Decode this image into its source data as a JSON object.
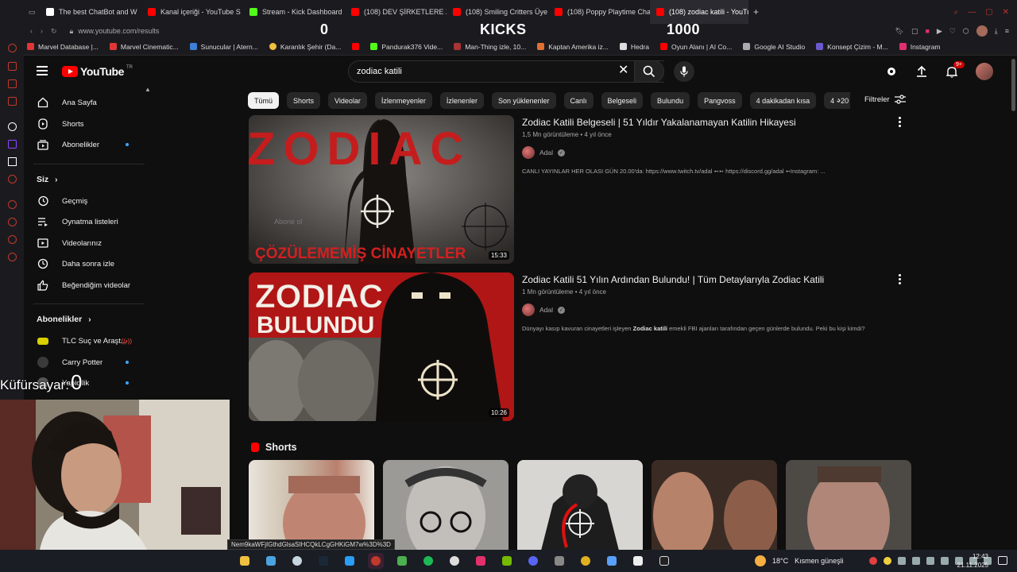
{
  "browser": {
    "tabs": [
      {
        "title": "The best ChatBot and W",
        "color": "#ffffff"
      },
      {
        "title": "Kanal içeriği - YouTube S",
        "color": "#ff0000"
      },
      {
        "title": "Stream - Kick Dashboard",
        "color": "#53fc18"
      },
      {
        "title": "(108) DEV ŞİRKETLERE Z",
        "color": "#ff0000"
      },
      {
        "title": "(108) Smiling Critters Üye",
        "color": "#ff0000"
      },
      {
        "title": "(108) Poppy Playtime Cha",
        "color": "#ff0000"
      },
      {
        "title": "(108) zodiac katili - YouTu",
        "color": "#ff0000"
      }
    ],
    "new_tab": "+",
    "url": "www.youtube.com/results",
    "stream_overlay": {
      "left": "0",
      "center": "KICKS",
      "right": "1000"
    },
    "bookmarks": [
      {
        "label": "Marvel Database |...",
        "color": "#e23636"
      },
      {
        "label": "Marvel Cinematic...",
        "color": "#e23636"
      },
      {
        "label": "Sunucular | Atern...",
        "color": "#3f7fd6"
      },
      {
        "label": "Karanlık Şehir (Da...",
        "color": "#f0c040"
      },
      {
        "label": "",
        "color": "#ff0000"
      },
      {
        "label": "Pandurak376 Vide...",
        "color": "#53fc18"
      },
      {
        "label": "Man-Thing izle, 10...",
        "color": "#aa3333"
      },
      {
        "label": "Kaptan Amerika iz...",
        "color": "#e07030"
      },
      {
        "label": "Hedra",
        "color": "#dddddd"
      },
      {
        "label": "Oyun Alanı | AI Co...",
        "color": "#ff0000"
      },
      {
        "label": "Google AI Studio",
        "color": "#aaaaaa"
      },
      {
        "label": "Konsept Çizim - M...",
        "color": "#6a5acd"
      },
      {
        "label": "Instagram",
        "color": "#e1306c"
      }
    ]
  },
  "youtube": {
    "logo_text": "YouTube",
    "logo_region": "TR",
    "search_value": "zodiac katili",
    "notifications_badge": "9+",
    "sidebar": {
      "main": [
        {
          "label": "Ana Sayfa",
          "icon": "home-icon"
        },
        {
          "label": "Shorts",
          "icon": "shorts-icon"
        },
        {
          "label": "Abonelikler",
          "icon": "subscriptions-icon"
        }
      ],
      "you_header": "Siz",
      "you": [
        {
          "label": "Geçmiş",
          "icon": "history-icon"
        },
        {
          "label": "Oynatma listeleri",
          "icon": "playlists-icon"
        },
        {
          "label": "Videolarınız",
          "icon": "your-videos-icon"
        },
        {
          "label": "Daha sonra izle",
          "icon": "watch-later-icon"
        },
        {
          "label": "Beğendiğim videolar",
          "icon": "liked-icon"
        }
      ],
      "subs_header": "Abonelikler",
      "subs": [
        {
          "label": "TLC Suç ve Araşt..."
        },
        {
          "label": "Carry Potter"
        },
        {
          "label": "Yapicilik"
        }
      ]
    },
    "chips": [
      "Tümü",
      "Shorts",
      "Videolar",
      "İzlenmeyenler",
      "İzlenenler",
      "Son yüklenenler",
      "Canlı",
      "Belgeseli",
      "Bulundu",
      "Pangvoss",
      "4 dakikadan kısa",
      "4 - 20 dakika"
    ],
    "filters_label": "Filtreler",
    "results": [
      {
        "title": "Zodiac Katili Belgeseli | 51 Yıldır Yakalanamayan Katilin Hikayesi",
        "meta": "1,5 Mn görüntüleme • 4 yıl önce",
        "channel": "Adal",
        "desc": "CANLI YAYINLAR HER OLASI GÜN 20.00'da: https://www.twitch.tv/adal ➻➻ https://discord.gg/adal ➻Instagram: ...",
        "duration": "15:33",
        "thumb_text": "ZODIAC",
        "thumb_caption": "ÇÖZÜLEMEMİŞ CİNAYETLER",
        "thumb_small": "Abone ol"
      },
      {
        "title": "Zodiac Katili 51 Yılın Ardından Bulundu! | Tüm Detaylarıyla Zodiac Katili",
        "meta": "1 Mn görüntüleme • 4 yıl önce",
        "channel": "Adal",
        "desc_pre": "Dünyayı kasıp kavuran cinayetleri işleyen ",
        "desc_bold": "Zodiac katili",
        "desc_post": " emekli FBI ajanları tarafından geçen günlerde bulundu. Peki bu kişi kimdi?",
        "duration": "10:26",
        "thumb_text": "ZODIAC",
        "thumb_text2": "BULUNDU"
      }
    ],
    "shorts_header": "Shorts"
  },
  "stream": {
    "counter_label": "Küfürsayar:",
    "counter_value": "0",
    "link_preview": "Nem9kaWFjIGthdGlsaSIHCQkLCgGHKiGM7w%3D%3D"
  },
  "taskbar": {
    "weather": "18°C",
    "weather_desc": "Kısmen güneşli",
    "time": "12:43",
    "date": "21.11.2025"
  }
}
